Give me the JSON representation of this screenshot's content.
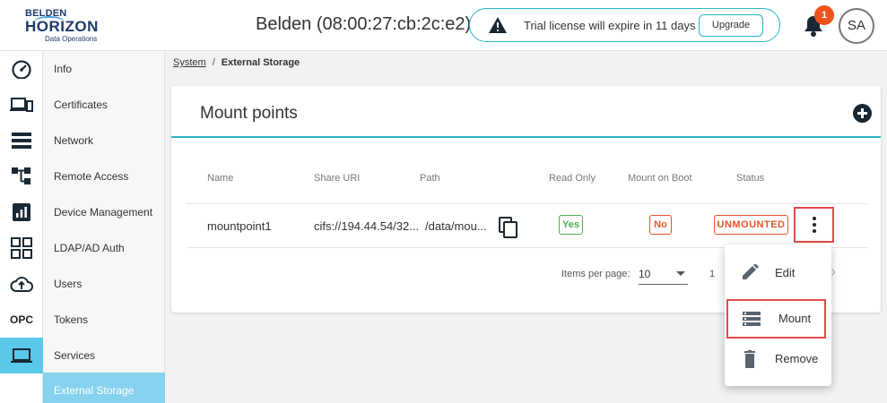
{
  "header": {
    "logo": {
      "line1": "BELDEN",
      "line2": "HORIZON",
      "line3": "Data Operations"
    },
    "device_title": "Belden (08:00:27:cb:2c:e2)",
    "trial_message": "Trial license will expire in 11 days",
    "upgrade_label": "Upgrade",
    "notification_count": "1",
    "avatar_initials": "SA"
  },
  "rail": {
    "items": [
      {
        "icon": "speedometer-icon"
      },
      {
        "icon": "devices-icon"
      },
      {
        "icon": "server-icon"
      },
      {
        "icon": "hierarchy-icon"
      },
      {
        "icon": "bar-chart-icon"
      },
      {
        "icon": "apps-grid-icon"
      },
      {
        "icon": "cloud-upload-icon"
      },
      {
        "icon": "opc-icon",
        "label": "OPC"
      },
      {
        "icon": "laptop-icon",
        "active": true
      }
    ]
  },
  "submenu": {
    "items": [
      {
        "label": "Info"
      },
      {
        "label": "Certificates"
      },
      {
        "label": "Network"
      },
      {
        "label": "Remote Access"
      },
      {
        "label": "Device Management"
      },
      {
        "label": "LDAP/AD Auth"
      },
      {
        "label": "Users"
      },
      {
        "label": "Tokens"
      },
      {
        "label": "Services"
      },
      {
        "label": "External Storage",
        "active": true
      }
    ]
  },
  "breadcrumb": {
    "parent": "System",
    "separator": "/",
    "current": "External Storage"
  },
  "card": {
    "title": "Mount points",
    "columns": [
      "Name",
      "Share URI",
      "Path",
      "Read Only",
      "Mount on Boot",
      "Status"
    ],
    "row": {
      "name": "mountpoint1",
      "share_uri": "cifs://194.44.54/32...",
      "path": "/data/mou...",
      "read_only": "Yes",
      "mount_on_boot": "No",
      "status": "UNMOUNTED"
    },
    "pagination": {
      "items_per_page_label": "Items per page:",
      "items_per_page_value": "10",
      "range": "1"
    }
  },
  "menu": {
    "items": [
      {
        "label": "Edit",
        "icon": "pencil-icon"
      },
      {
        "label": "Mount",
        "icon": "server-icon"
      },
      {
        "label": "Remove",
        "icon": "trash-icon"
      }
    ]
  },
  "colors": {
    "accent": "#2bb5c5",
    "active_rail": "#5ac8e9",
    "active_submenu": "#86d3ef",
    "danger": "#e8542a",
    "success": "#4caf50",
    "badge": "#f0521e"
  }
}
